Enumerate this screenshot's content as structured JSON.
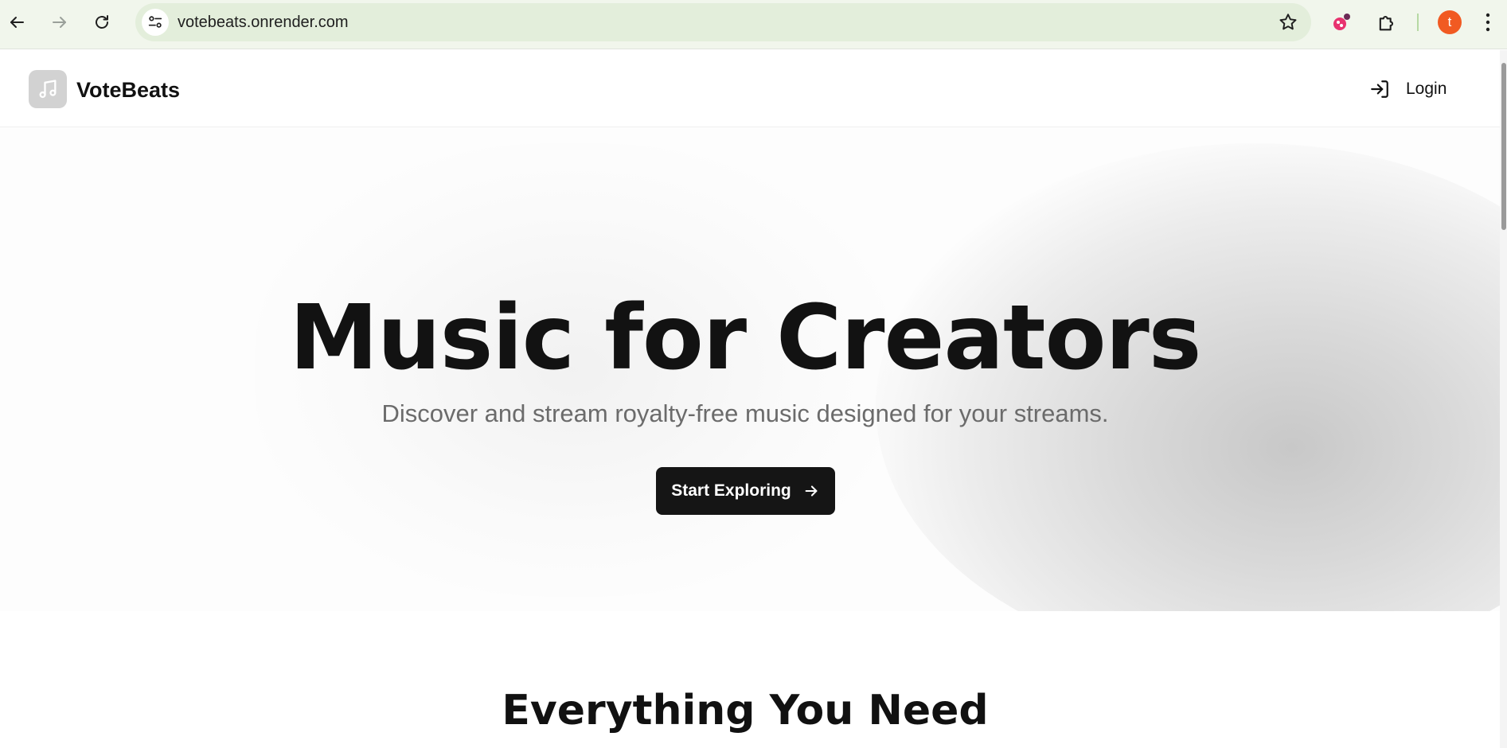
{
  "browser": {
    "url": "votebeats.onrender.com",
    "profile_initial": "t",
    "icons": {
      "back": "arrow-left-icon",
      "forward": "arrow-right-icon",
      "reload": "reload-icon",
      "site_info": "tune-icon",
      "bookmark": "star-icon",
      "extension_1": "extension-colorful-icon",
      "extensions": "puzzle-icon",
      "menu": "kebab-menu-icon"
    }
  },
  "header": {
    "brand": "VoteBeats",
    "login_label": "Login",
    "icons": {
      "logo": "music-note-icon",
      "login": "log-in-icon"
    }
  },
  "hero": {
    "title": "Music for Creators",
    "subtitle": "Discover and stream royalty-free music designed for your streams.",
    "cta_label": "Start Exploring",
    "cta_icon": "arrow-right-icon"
  },
  "features": {
    "title": "Everything You Need"
  },
  "colors": {
    "browser_bar": "#f1f6ec",
    "omnibox": "#e3eedb",
    "cta_background": "#151515",
    "profile_avatar": "#f15a22",
    "logo_tile": "#d2d2d2"
  }
}
